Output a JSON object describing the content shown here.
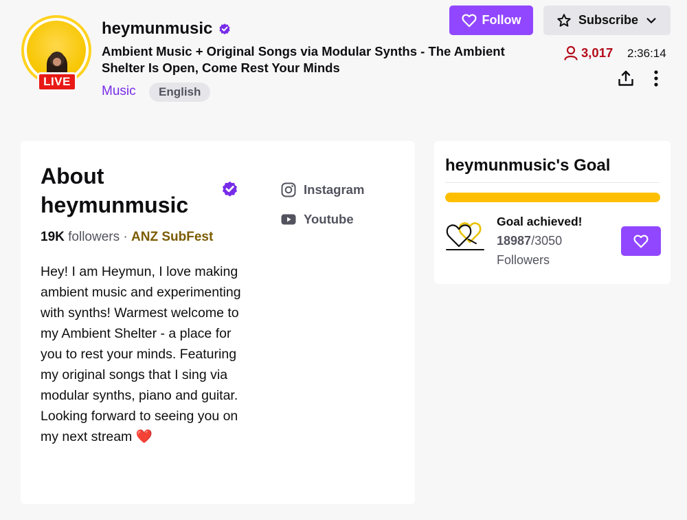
{
  "colors": {
    "accent": "#9147ff",
    "live_red": "#e91916",
    "viewer_red": "#b40d1b",
    "goal_yellow": "#ffbf00",
    "team_gold": "#7c5c00",
    "category_purple": "#772ce8"
  },
  "header": {
    "channel_name": "heymunmusic",
    "live_label": "LIVE",
    "stream_title": "Ambient Music + Original Songs via Modular Synths - The Ambient Shelter Is Open, Come Rest Your Minds",
    "category": "Music",
    "tag": "English",
    "follow_label": "Follow",
    "subscribe_label": "Subscribe",
    "viewer_count": "3,017",
    "uptime": "2:36:14",
    "icons": {
      "verified": "verified-badge-icon",
      "heart": "heart-icon",
      "star": "star-icon",
      "chevron": "chevron-down-icon",
      "viewers": "person-icon",
      "share": "share-icon",
      "more": "more-vertical-icon"
    }
  },
  "about": {
    "title": "About heymunmusic",
    "followers_count": "19K",
    "followers_label": "followers",
    "separator": "·",
    "team": "ANZ SubFest",
    "bio": "Hey! I am Heymun, I love making ambient music and experimenting with synths! Warmest welcome to my Ambient Shelter - a place for you to rest your minds. Featuring my original songs that I sing via modular synths, piano and guitar. Looking forward to seeing you on my next stream ❤️",
    "socials": [
      {
        "label": "Instagram",
        "icon": "instagram-icon"
      },
      {
        "label": "Youtube",
        "icon": "youtube-icon"
      }
    ]
  },
  "goal": {
    "title": "heymunmusic's Goal",
    "status": "Goal achieved!",
    "current": "18987",
    "target": "/3050",
    "unit": "Followers",
    "progress_fraction": 1.0,
    "icon": "two-hearts-icon"
  }
}
